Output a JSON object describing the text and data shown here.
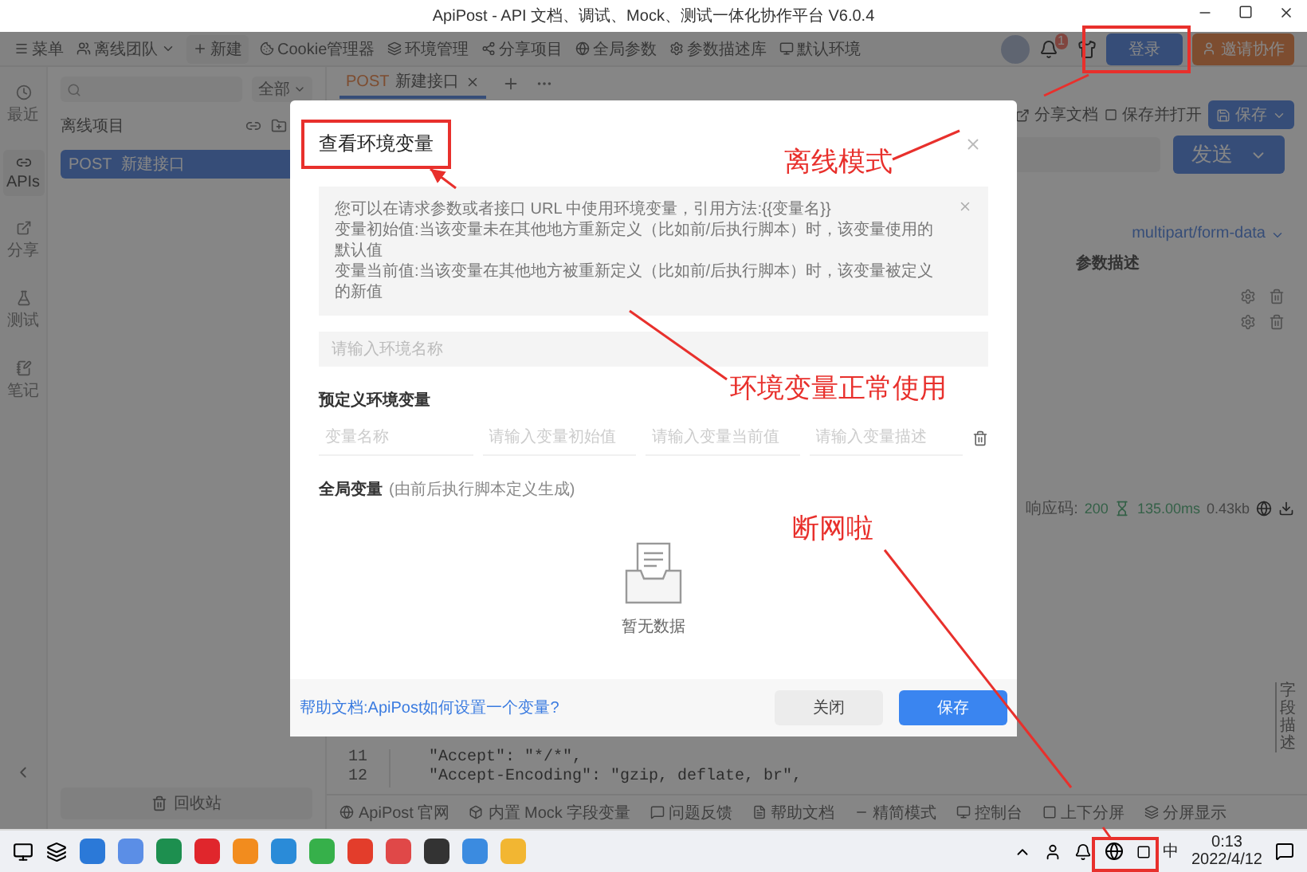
{
  "window": {
    "title": "ApiPost - API 文档、调试、Mock、测试一体化协作平台 V6.0.4"
  },
  "toolbar": {
    "menu": "菜单",
    "team": "离线团队",
    "new": "新建",
    "notifications": "1",
    "login": "登录",
    "invite": "邀请协作",
    "items": [
      {
        "label": "Cookie管理器"
      },
      {
        "label": "环境管理"
      },
      {
        "label": "分享项目"
      },
      {
        "label": "全局参数"
      },
      {
        "label": "参数描述库"
      },
      {
        "label": "默认环境"
      }
    ]
  },
  "rail": [
    {
      "label": "最近",
      "selected": false
    },
    {
      "label": "APIs",
      "selected": true
    },
    {
      "label": "分享",
      "selected": false
    },
    {
      "label": "测试",
      "selected": false
    },
    {
      "label": "笔记",
      "selected": false
    }
  ],
  "sidebar": {
    "filter": "全部",
    "project": "离线项目",
    "trash": "回收站",
    "items": [
      {
        "method": "POST",
        "name": "新建接口",
        "selected": true
      }
    ]
  },
  "tabs": [
    {
      "method": "POST",
      "name": "新建接口",
      "selected": true
    }
  ],
  "request": {
    "share": "分享文档",
    "save_open": "保存并打开",
    "save": "保存",
    "send": "发送",
    "content_type": "multipart/form-data",
    "param_header": "参数描述"
  },
  "response": {
    "code_label": "响应码:",
    "code": "200",
    "time": "135.00ms",
    "size": "0.43kb"
  },
  "side_tab": "字段描述",
  "code_lines": [
    {
      "number": "11",
      "text": "\"Accept\": \"*/*\","
    },
    {
      "number": "12",
      "text": "\"Accept-Encoding\": \"gzip, deflate, br\","
    }
  ],
  "bottom_bar": [
    {
      "label": "ApiPost 官网"
    },
    {
      "label": "内置 Mock 字段变量"
    },
    {
      "label": "问题反馈"
    },
    {
      "label": "帮助文档"
    },
    {
      "label": "精简模式"
    },
    {
      "label": "控制台"
    },
    {
      "label": "上下分屏"
    },
    {
      "label": "分屏显示"
    }
  ],
  "modal": {
    "title": "查看环境变量",
    "notice": [
      "您可以在请求参数或者接口 URL 中使用环境变量，引用方法:{{变量名}}",
      "变量初始值:当该变量未在其他地方重新定义（比如前/后执行脚本）时，该变量使用的默认值",
      "变量当前值:当该变量在其他地方被重新定义（比如前/后执行脚本）时，该变量被定义的新值"
    ],
    "env_name_placeholder": "请输入环境名称",
    "predefined_title": "预定义环境变量",
    "variable_fields": [
      {
        "placeholder": "变量名称"
      },
      {
        "placeholder": "请输入变量初始值"
      },
      {
        "placeholder": "请输入变量当前值"
      },
      {
        "placeholder": "请输入变量描述"
      }
    ],
    "global_title": "全局变量",
    "global_hint": "(由前后执行脚本定义生成)",
    "empty": "暂无数据",
    "help_link": "帮助文档:ApiPost如何设置一个变量?",
    "close": "关闭",
    "save": "保存"
  },
  "annotations": [
    {
      "text": "离线模式"
    },
    {
      "text": "环境变量正常使用"
    },
    {
      "text": "断网啦"
    }
  ],
  "taskbar": {
    "ime": "中",
    "time": "0:13",
    "date": "2022/4/12"
  }
}
